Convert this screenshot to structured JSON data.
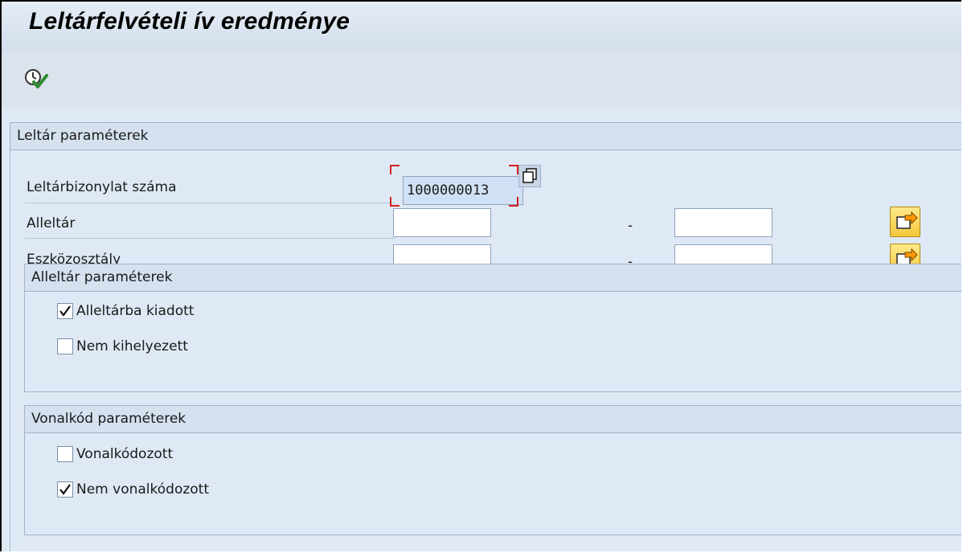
{
  "window": {
    "title": "Leltárfelvételi ív eredménye"
  },
  "toolbar": {
    "execute_icon": "execute-clock-check-icon"
  },
  "main_group": {
    "header": "Leltár paraméterek",
    "fields": [
      {
        "label": "Leltárbizonylat száma",
        "value": "1000000013"
      },
      {
        "label": "Alleltár",
        "from": "",
        "separator": "-",
        "to": ""
      },
      {
        "label": "Eszközosztály",
        "from": "",
        "separator": "-",
        "to": ""
      }
    ]
  },
  "sub_group_1": {
    "header": "Alleltár paraméterek",
    "checkboxes": [
      {
        "label": "Alleltárba kiadott",
        "checked": true
      },
      {
        "label": "Nem kihelyezett",
        "checked": false
      }
    ]
  },
  "sub_group_2": {
    "header": "Vonalkód paraméterek",
    "checkboxes": [
      {
        "label": "Vonalkódozott",
        "checked": false
      },
      {
        "label": "Nem vonalkódozott",
        "checked": true
      }
    ]
  },
  "colors": {
    "background": "#dfe9f5",
    "focus_marker": "#d62020",
    "multi_select_button": "#f5c73d"
  }
}
